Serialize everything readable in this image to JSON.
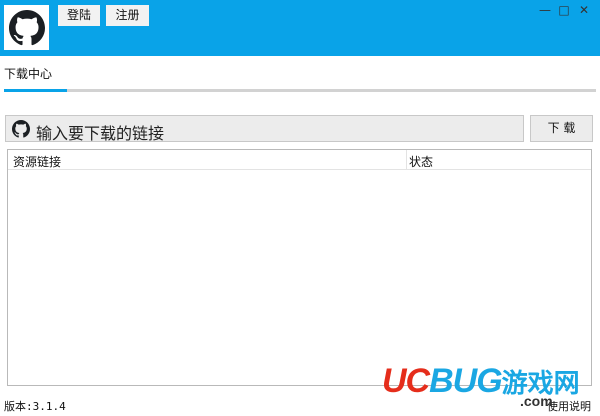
{
  "header": {
    "login_label": "登陆",
    "register_label": "注册",
    "win_minimize": "—",
    "win_maximize": "□",
    "win_close": "✕"
  },
  "tabs": [
    {
      "label": "下载中心",
      "active": true
    }
  ],
  "download": {
    "placeholder": "输入要下载的链接",
    "button_label": "下 载"
  },
  "table": {
    "columns": [
      "资源链接",
      "状态"
    ],
    "rows": []
  },
  "footer": {
    "version": "版本:3.1.4",
    "help": "使用说明"
  },
  "watermark": {
    "uc": "UC",
    "bug": "BUG",
    "cn": "游戏网",
    "com": ".com"
  },
  "colors": {
    "accent": "#09a3e8",
    "button_bg": "#ececec"
  },
  "icons": [
    "github-icon"
  ]
}
